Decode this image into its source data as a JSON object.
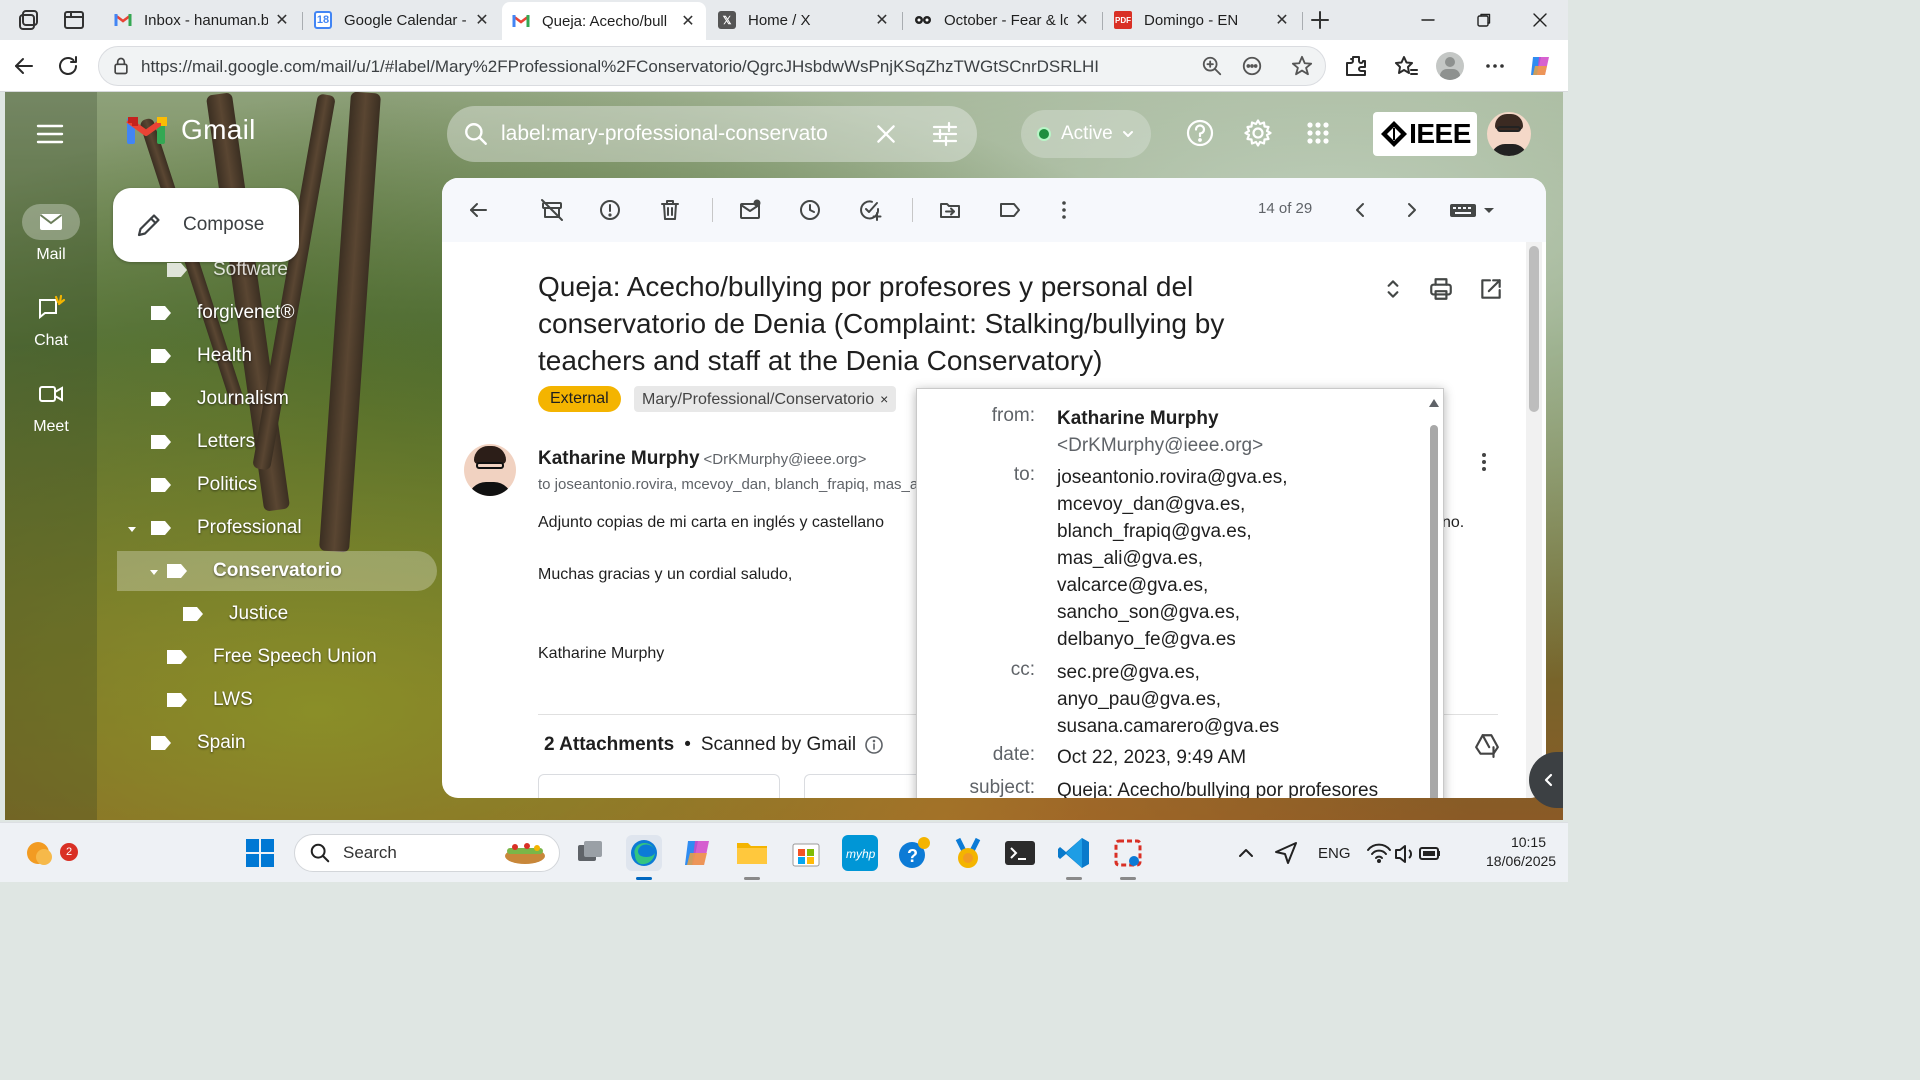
{
  "browser": {
    "tabs": [
      {
        "label": "Inbox - hanuman.b",
        "favicon": "gmail-icon"
      },
      {
        "label": "Google Calendar - ",
        "favicon": "calendar-icon",
        "favicon_text": "18"
      },
      {
        "label": "Queja: Acecho/bull",
        "favicon": "gmail-icon",
        "active": true
      },
      {
        "label": "Home / X",
        "favicon": "x-icon"
      },
      {
        "label": "October - Fear & lo",
        "favicon": "panda-icon"
      },
      {
        "label": "Domingo - EN",
        "favicon": "pdf-icon"
      }
    ],
    "url": "https://mail.google.com/mail/u/1/#label/Mary%2FProfessional%2FConservatorio/QgrcJHsbdwWsPnjKSqZhzTWGtSCnrDSRLHI"
  },
  "gmail": {
    "product_name": "Gmail",
    "search_query": "label:mary-professional-conservato",
    "status": "Active",
    "org_badge": "IEEE",
    "compose_label": "Compose",
    "rail": [
      {
        "label": "Mail",
        "icon": "mail-icon"
      },
      {
        "label": "Chat",
        "icon": "chat-icon"
      },
      {
        "label": "Meet",
        "icon": "video-icon"
      }
    ],
    "folders": [
      {
        "label": "Software"
      },
      {
        "label": "forgivenet®"
      },
      {
        "label": "Health"
      },
      {
        "label": "Journalism"
      },
      {
        "label": "Letters"
      },
      {
        "label": "Politics"
      },
      {
        "label": "Professional"
      },
      {
        "label": "Conservatorio"
      },
      {
        "label": "Justice"
      },
      {
        "label": "Free Speech Union"
      },
      {
        "label": "LWS"
      },
      {
        "label": "Spain"
      }
    ]
  },
  "toolbar": {
    "pager": "14 of 29"
  },
  "email": {
    "subject": "Queja: Acecho/bullying por profesores y personal del conservatorio de Denia (Complaint: Stalking/bullying by teachers and staff at the Denia Conservatory)",
    "labels": {
      "external": "External",
      "folder": "Mary/Professional/Conservatorio",
      "remove": "×"
    },
    "sender_name": "Katharine Murphy",
    "sender_email": "<DrKMurphy@ieee.org>",
    "to_summary": "to joseantonio.rovira, mcevoy_dan, blanch_frapiq, mas_ali",
    "body": [
      "Adjunto copias de mi carta en inglés y castellano",
      "Muchas gracias y un cordial saludo,",
      "Katharine Murphy"
    ],
    "body_tail": "no.",
    "attachments_title": "2 Attachments",
    "attachments_note": "Scanned by Gmail",
    "attachments_dot": "•"
  },
  "details": {
    "from_label": "from:",
    "from_name": "Katharine Murphy",
    "from_email": "<DrKMurphy@ieee.org>",
    "to_label": "to:",
    "to": [
      "joseantonio.rovira@gva.es,",
      "mcevoy_dan@gva.es,",
      "blanch_frapiq@gva.es,",
      "mas_ali@gva.es,",
      "valcarce@gva.es,",
      "sancho_son@gva.es,",
      "delbanyo_fe@gva.es"
    ],
    "cc_label": "cc:",
    "cc": [
      "sec.pre@gva.es,",
      "anyo_pau@gva.es,",
      "susana.camarero@gva.es"
    ],
    "date_label": "date:",
    "date": "Oct 22, 2023, 9:49 AM",
    "subject_label": "subject:",
    "subject": "Queja: Acecho/bullying por profesores"
  },
  "taskbar": {
    "search_label": "Search",
    "notification_count": "2",
    "language": "ENG",
    "time": "10:15",
    "date": "18/06/2025"
  }
}
